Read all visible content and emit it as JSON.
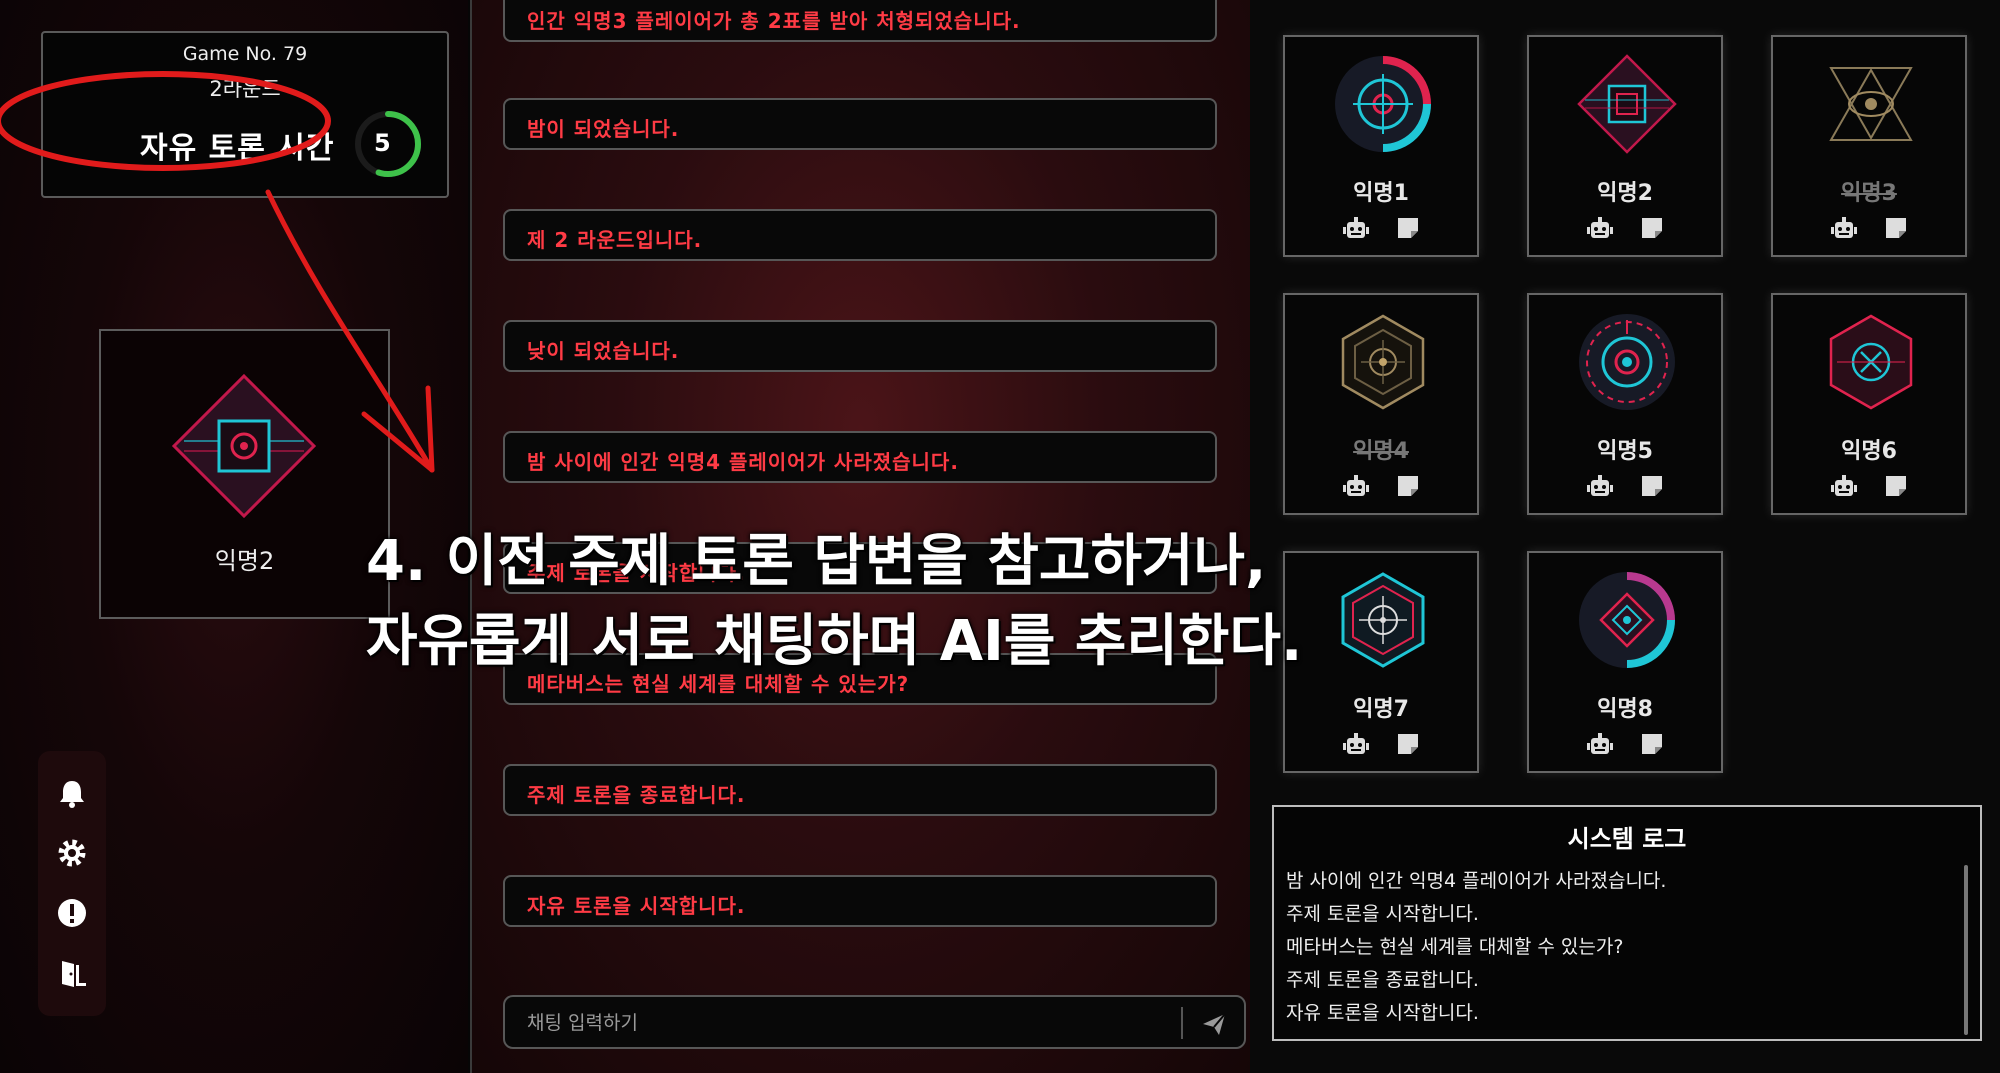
{
  "game": {
    "number_label": "Game No. 79",
    "round_label": "2라운드",
    "phase_label": "자유 토론 시간",
    "timer_value": "5",
    "timer_progress": 0.55
  },
  "me": {
    "name": "익명2"
  },
  "chat": {
    "messages": [
      "인간 익명3 플레이어가 총 2표를 받아 처형되었습니다.",
      "밤이 되었습니다.",
      "제 2 라운드입니다.",
      "낮이 되었습니다.",
      "밤 사이에 인간 익명4 플레이어가 사라졌습니다.",
      "주제 토론을 시작합니다.",
      "메타버스는 현실 세계를 대체할 수 있는가?",
      "주제 토론을 종료합니다.",
      "자유 토론을 시작합니다."
    ],
    "input_placeholder": "채팅 입력하기"
  },
  "caption": {
    "line1": "4. 이전 주제 토론 답변을 참고하거나,",
    "line2": "자유롭게 서로 채팅하며 AI를 추리한다."
  },
  "players": [
    {
      "name": "익명1",
      "eliminated": false,
      "icon": "target-ring-icon"
    },
    {
      "name": "익명2",
      "eliminated": false,
      "icon": "diamond-square-icon"
    },
    {
      "name": "익명3",
      "eliminated": true,
      "icon": "eye-triangle-icon"
    },
    {
      "name": "익명4",
      "eliminated": true,
      "icon": "gold-hexagon-icon"
    },
    {
      "name": "익명5",
      "eliminated": false,
      "icon": "binary-ring-icon"
    },
    {
      "name": "익명6",
      "eliminated": false,
      "icon": "cross-hexagon-icon"
    },
    {
      "name": "익명7",
      "eliminated": false,
      "icon": "crosshair-hexagon-icon"
    },
    {
      "name": "익명8",
      "eliminated": false,
      "icon": "diamond-ring-icon"
    }
  ],
  "system_log": {
    "title": "시스템 로그",
    "lines": [
      "밤 사이에 인간 익명4 플레이어가 사라졌습니다.",
      "주제 토론을 시작합니다.",
      "메타버스는 현실 세계를 대체할 수 있는가?",
      "주제 토론을 종료합니다.",
      "자유 토론을 시작합니다."
    ]
  },
  "toolbar": {
    "icons": [
      "bell-icon",
      "gear-icon",
      "alert-icon",
      "exit-door-icon"
    ]
  },
  "colors": {
    "accent_red": "#ff3b45",
    "timer_green": "#3ec24a",
    "annotation_red": "#e11b1b",
    "cyan": "#1fc6d6",
    "crimson": "#e0234e"
  }
}
